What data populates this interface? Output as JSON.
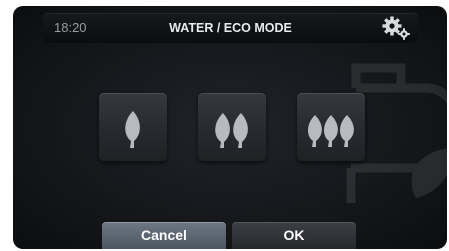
{
  "header": {
    "time": "18:20",
    "title": "WATER / ECO MODE",
    "settings_icon": "gears-icon"
  },
  "modes": [
    {
      "icon": "single-leaf-icon",
      "leaves": 1
    },
    {
      "icon": "double-leaf-icon",
      "leaves": 2
    },
    {
      "icon": "triple-leaf-icon",
      "leaves": 3
    }
  ],
  "buttons": {
    "cancel_label": "Cancel",
    "ok_label": "OK"
  },
  "colors": {
    "leaf": "#b7babe",
    "background": "#15171a",
    "cancel_button": "#5b6670"
  }
}
